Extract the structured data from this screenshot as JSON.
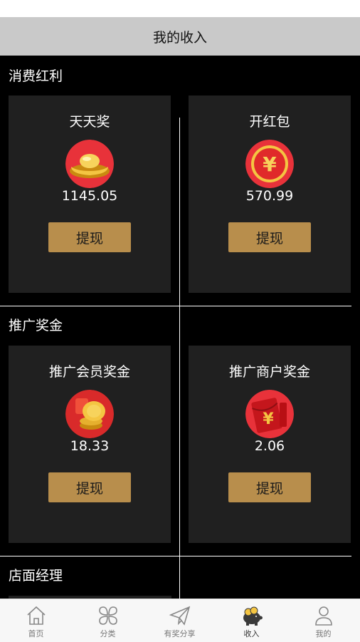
{
  "header": {
    "title": "我的收入"
  },
  "sections": [
    {
      "title": "消费红利",
      "cards": [
        {
          "name": "天天奖",
          "amount": "1145.05",
          "button": "提现",
          "icon": "gold-ingot-icon"
        },
        {
          "name": "开红包",
          "amount": "570.99",
          "button": "提现",
          "icon": "yuan-coin-icon"
        }
      ]
    },
    {
      "title": "推广奖金",
      "cards": [
        {
          "name": "推广会员奖金",
          "amount": "18.33",
          "button": "提现",
          "icon": "coin-stack-icon"
        },
        {
          "name": "推广商户奖金",
          "amount": "2.06",
          "button": "提现",
          "icon": "red-envelope-icon"
        }
      ]
    },
    {
      "title": "店面经理"
    }
  ],
  "tabbar": {
    "items": [
      {
        "label": "首页",
        "icon": "home-icon"
      },
      {
        "label": "分类",
        "icon": "category-icon"
      },
      {
        "label": "有奖分享",
        "icon": "paper-plane-icon"
      },
      {
        "label": "收入",
        "icon": "piggy-bank-icon",
        "active": true
      },
      {
        "label": "我的",
        "icon": "user-icon"
      }
    ]
  },
  "colors": {
    "button": "#b88e4c",
    "card": "#202020",
    "background": "#000000",
    "navbar": "#c9c9c9"
  }
}
